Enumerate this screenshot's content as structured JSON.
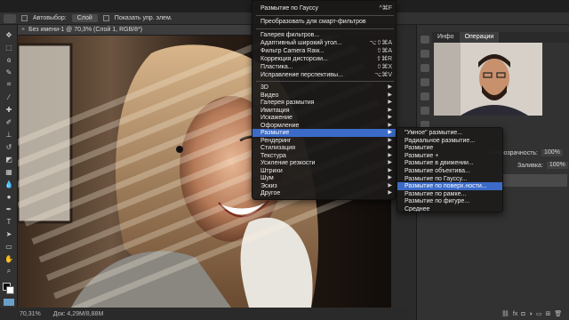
{
  "options_bar": {
    "autoselect_label": "Автовыбор:",
    "autoselect_value": "Слой",
    "show_controls_label": "Показать упр. элем."
  },
  "document": {
    "tab_title": "Без имени-1 @ 70,3% (Слой 1, RGB/8*)"
  },
  "status_bar": {
    "zoom": "70,31%",
    "doc_info": "Док: 4,29M/8,88M"
  },
  "filter_menu": {
    "items": [
      {
        "label": "Размытие по Гауссу",
        "shortcut": "^⌘F"
      },
      {
        "label": "Преобразовать для смарт-фильтров",
        "shortcut": ""
      },
      {
        "label": "Галерея фильтров...",
        "shortcut": ""
      },
      {
        "label": "Адаптивный широкий угол...",
        "shortcut": "⌥⇧⌘A"
      },
      {
        "label": "Фильтр Camera Raw...",
        "shortcut": "⇧⌘A"
      },
      {
        "label": "Коррекция дисторсии...",
        "shortcut": "⇧⌘R"
      },
      {
        "label": "Пластика...",
        "shortcut": "⇧⌘X"
      },
      {
        "label": "Исправление перспективы...",
        "shortcut": "⌥⌘V"
      }
    ],
    "submenu_items": [
      {
        "label": "3D"
      },
      {
        "label": "Видео"
      },
      {
        "label": "Галерея размытия"
      },
      {
        "label": "Имитация"
      },
      {
        "label": "Искажение"
      },
      {
        "label": "Оформление"
      },
      {
        "label": "Размытие"
      },
      {
        "label": "Рендеринг"
      },
      {
        "label": "Стилизация"
      },
      {
        "label": "Текстура"
      },
      {
        "label": "Усиление резкости"
      },
      {
        "label": "Штрихи"
      },
      {
        "label": "Шум"
      },
      {
        "label": "Эскиз"
      },
      {
        "label": "Другое"
      }
    ],
    "highlighted": "Размытие"
  },
  "blur_submenu": {
    "items": [
      "\"Умное\" размытие...",
      "Радиальное размытие...",
      "Размытие",
      "Размытие +",
      "Размытие в движении...",
      "Размытие объектива...",
      "Размытие по Гауссу...",
      "Размытие по поверх.ности...",
      "Размытие по рамке...",
      "Размытие по фигуре...",
      "Среднее"
    ],
    "highlighted": "Размытие по поверх.ности..."
  },
  "right_panel": {
    "tabs": [
      "Инфо",
      "Операции"
    ],
    "opacity_label": "Непрозрачность:",
    "opacity_value": "100%",
    "fill_label": "Заливка:",
    "fill_value": "100%"
  },
  "colors": {
    "menu_highlight": "#3c6bc7",
    "panel_bg": "#323232"
  }
}
